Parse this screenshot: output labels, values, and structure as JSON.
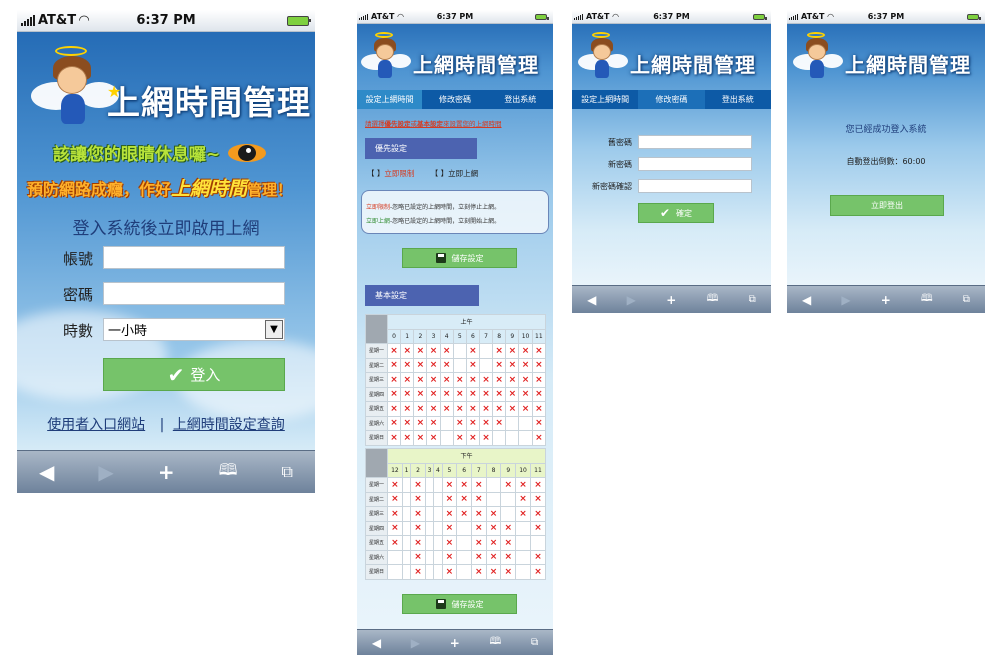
{
  "common": {
    "carrier": "AT&T",
    "time": "6:37 PM",
    "app_title": "上網時間管理"
  },
  "phone1": {
    "slogan1": "該讓您的眼睛休息囉~",
    "slogan2_a": "預防網路成癮，作好",
    "slogan2_b": "上網時間",
    "slogan2_c": "管理！",
    "login_heading": "登入系統後立即啟用上網",
    "account_label": "帳號",
    "account_value": "",
    "password_label": "密碼",
    "password_value": "",
    "hours_label": "時數",
    "hours_selected": "一小時",
    "login_button": "登入",
    "link_portal": "使用者入口網站",
    "link_divider": "|",
    "link_query": "上網時間設定查詢"
  },
  "tabs": [
    "設定上網時間",
    "修改密碼",
    "登出系統"
  ],
  "phone2": {
    "notice_a": "請選擇",
    "notice_b": "優先設定",
    "notice_c": "或",
    "notice_d": "基本設定",
    "notice_e": "來設置您的上網時間",
    "priority_header": "優先設定",
    "opt1_bracket": "【  】",
    "opt1_label": "立即限制",
    "opt2_bracket": "【  】",
    "opt2_label": "立即上網",
    "desc1_a": "立即限制",
    "desc1_b": "-忽略已設定的上網時間，立刻停止上網。",
    "desc2_a": "立即上網",
    "desc2_b": "-忽略已設定的上網時間，立刻開始上網。",
    "save_button": "儲存設定",
    "basic_header": "基本設定",
    "am_label": "上午",
    "pm_label": "下午",
    "am_hours": [
      "0",
      "1",
      "2",
      "3",
      "4",
      "5",
      "6",
      "7",
      "8",
      "9",
      "10",
      "11"
    ],
    "pm_hours": [
      "12",
      "1",
      "2",
      "3",
      "4",
      "5",
      "6",
      "7",
      "8",
      "9",
      "10",
      "11"
    ],
    "days": [
      "星期一",
      "星期二",
      "星期三",
      "星期四",
      "星期五",
      "星期六",
      "星期日"
    ],
    "mark": "×",
    "am_grid": [
      [
        1,
        1,
        1,
        1,
        1,
        0,
        1,
        0,
        1,
        1,
        1,
        1
      ],
      [
        1,
        1,
        1,
        1,
        1,
        0,
        1,
        0,
        1,
        1,
        1,
        1
      ],
      [
        1,
        1,
        1,
        1,
        1,
        1,
        1,
        1,
        1,
        1,
        1,
        1
      ],
      [
        1,
        1,
        1,
        1,
        1,
        1,
        1,
        1,
        1,
        1,
        1,
        1
      ],
      [
        1,
        1,
        1,
        1,
        1,
        1,
        1,
        1,
        1,
        1,
        1,
        1
      ],
      [
        1,
        1,
        1,
        1,
        0,
        1,
        1,
        1,
        1,
        0,
        0,
        1
      ],
      [
        1,
        1,
        1,
        1,
        0,
        1,
        1,
        1,
        0,
        0,
        0,
        1
      ]
    ],
    "pm_grid": [
      [
        1,
        0,
        1,
        0,
        0,
        1,
        1,
        1,
        0,
        1,
        1,
        1
      ],
      [
        1,
        0,
        1,
        0,
        0,
        1,
        1,
        1,
        0,
        0,
        1,
        1
      ],
      [
        1,
        0,
        1,
        0,
        0,
        1,
        1,
        1,
        1,
        0,
        1,
        1
      ],
      [
        1,
        0,
        1,
        0,
        0,
        1,
        0,
        1,
        1,
        1,
        0,
        1
      ],
      [
        1,
        0,
        1,
        0,
        0,
        1,
        0,
        1,
        1,
        1,
        0,
        0
      ],
      [
        0,
        0,
        1,
        0,
        0,
        1,
        0,
        1,
        1,
        1,
        0,
        1
      ],
      [
        0,
        0,
        1,
        0,
        0,
        1,
        0,
        1,
        1,
        1,
        0,
        1
      ]
    ],
    "save_button2": "儲存設定"
  },
  "phone3": {
    "old_pw_label": "舊密碼",
    "new_pw_label": "新密碼",
    "confirm_pw_label": "新密碼確認",
    "confirm_button": "確定"
  },
  "phone4": {
    "message": "您已經成功登入系統",
    "countdown_label": "自動登出倒數：",
    "countdown_value": "60:00",
    "logout_button": "立即登出"
  },
  "toolbar_icons": [
    "back-icon",
    "forward-icon",
    "add-icon",
    "bookmarks-icon",
    "pages-icon"
  ],
  "colors": {
    "sky_top": "#1f66b2",
    "tab_bar": "#0d5aa6",
    "green_button": "#76c36a",
    "section_header": "#4c63b0",
    "mark_red": "#e02020"
  }
}
